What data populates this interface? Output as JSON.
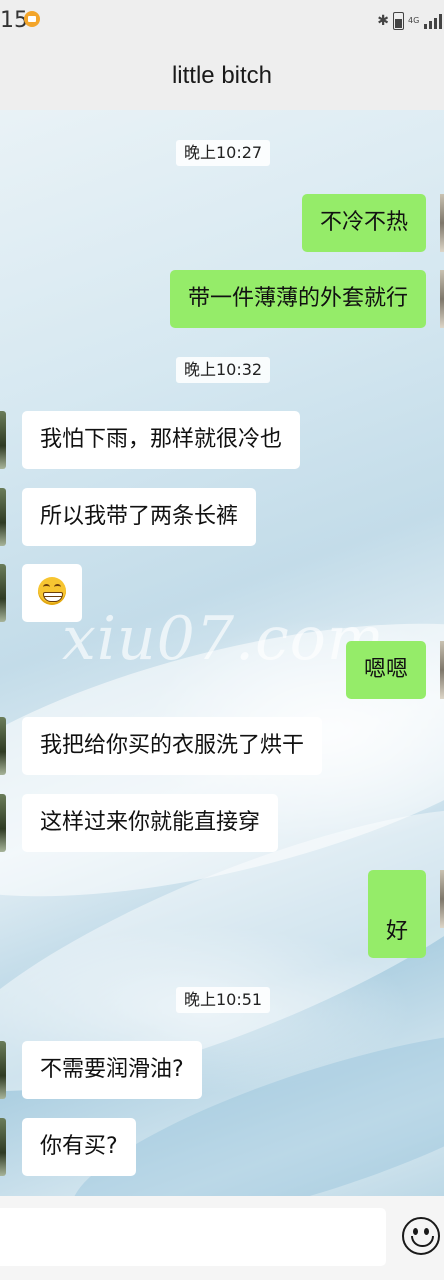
{
  "status_bar": {
    "time": "15",
    "network": "4G"
  },
  "header": {
    "title": "little bitch"
  },
  "watermark": "xiu07.com",
  "timestamps": [
    "晚上10:27",
    "晚上10:32",
    "晚上10:51"
  ],
  "messages": [
    {
      "side": "out",
      "text": "不冷不热"
    },
    {
      "side": "out",
      "text": "带一件薄薄的外套就行"
    },
    {
      "side": "in",
      "text": "我怕下雨，那样就很冷也"
    },
    {
      "side": "in",
      "text": "所以我带了两条长裤"
    },
    {
      "side": "in",
      "text": "",
      "emoji": "grinning-face"
    },
    {
      "side": "out",
      "text": "嗯嗯"
    },
    {
      "side": "in",
      "text": "我把给你买的衣服洗了烘干"
    },
    {
      "side": "in",
      "text": "这样过来你就能直接穿"
    },
    {
      "side": "out",
      "text": "好"
    },
    {
      "side": "in",
      "text": "不需要润滑油?"
    },
    {
      "side": "in",
      "text": "你有买?"
    }
  ],
  "input": {
    "value": "",
    "emoji_button_icon": "smiley-face-icon"
  },
  "colors": {
    "outgoing_bubble": "#95ec69",
    "incoming_bubble": "#ffffff",
    "bar_background": "#eeeeee"
  }
}
